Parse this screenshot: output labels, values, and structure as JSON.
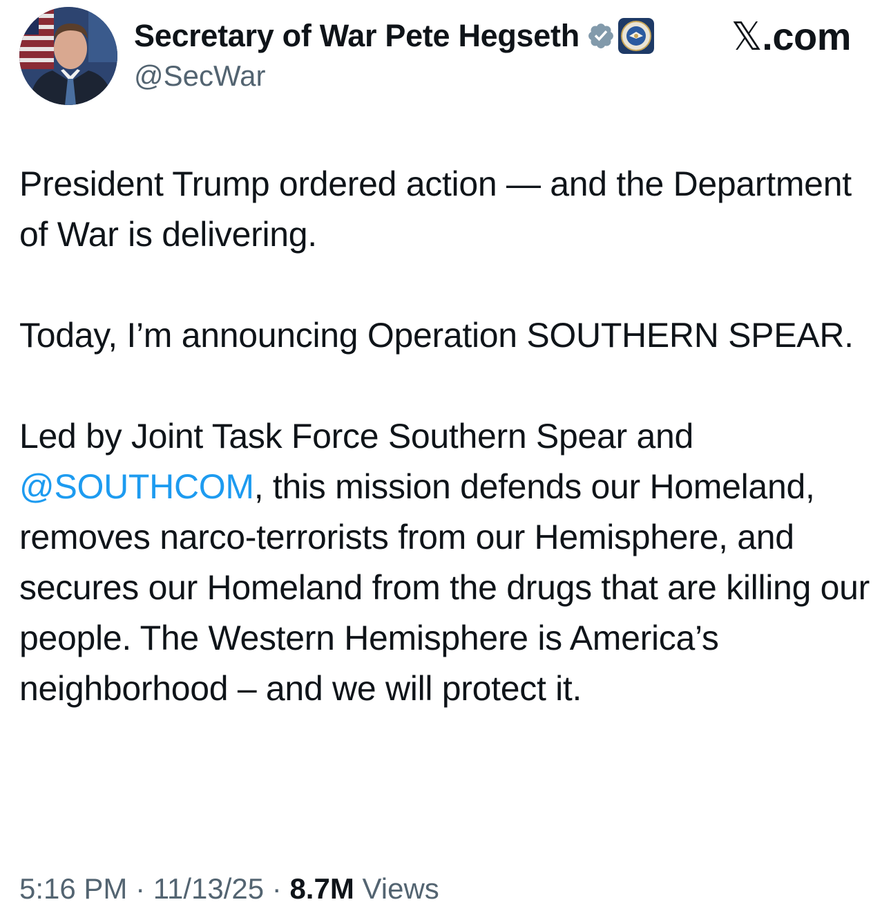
{
  "header": {
    "display_name": "Secretary of War Pete Hegseth",
    "handle": "@SecWar",
    "site_label_x": "𝕏",
    "site_label_rest": ".com",
    "verified_badge_color": "#829aab",
    "avatar_icon": "profile-photo",
    "affiliate_icon": "department-seal"
  },
  "tweet": {
    "paragraph_1": "President Trump ordered action — and the Department of War is delivering.",
    "paragraph_2": "Today, I’m announcing Operation SOUTHERN SPEAR.",
    "paragraph_3_before": "Led by Joint Task Force Southern Spear and ",
    "paragraph_3_mention": "@SOUTHCOM",
    "paragraph_3_after": ", this mission defends our Homeland, removes narco-terrorists from our Hemisphere, and secures our Homeland from the drugs that are killing our people. The Western Hemisphere is America’s neighborhood – and we will protect it.",
    "mention_color": "#1d9bf0"
  },
  "meta": {
    "time": "5:16 PM",
    "separator": " · ",
    "date": "11/13/25",
    "views_count": "8.7M",
    "views_label": " Views"
  }
}
